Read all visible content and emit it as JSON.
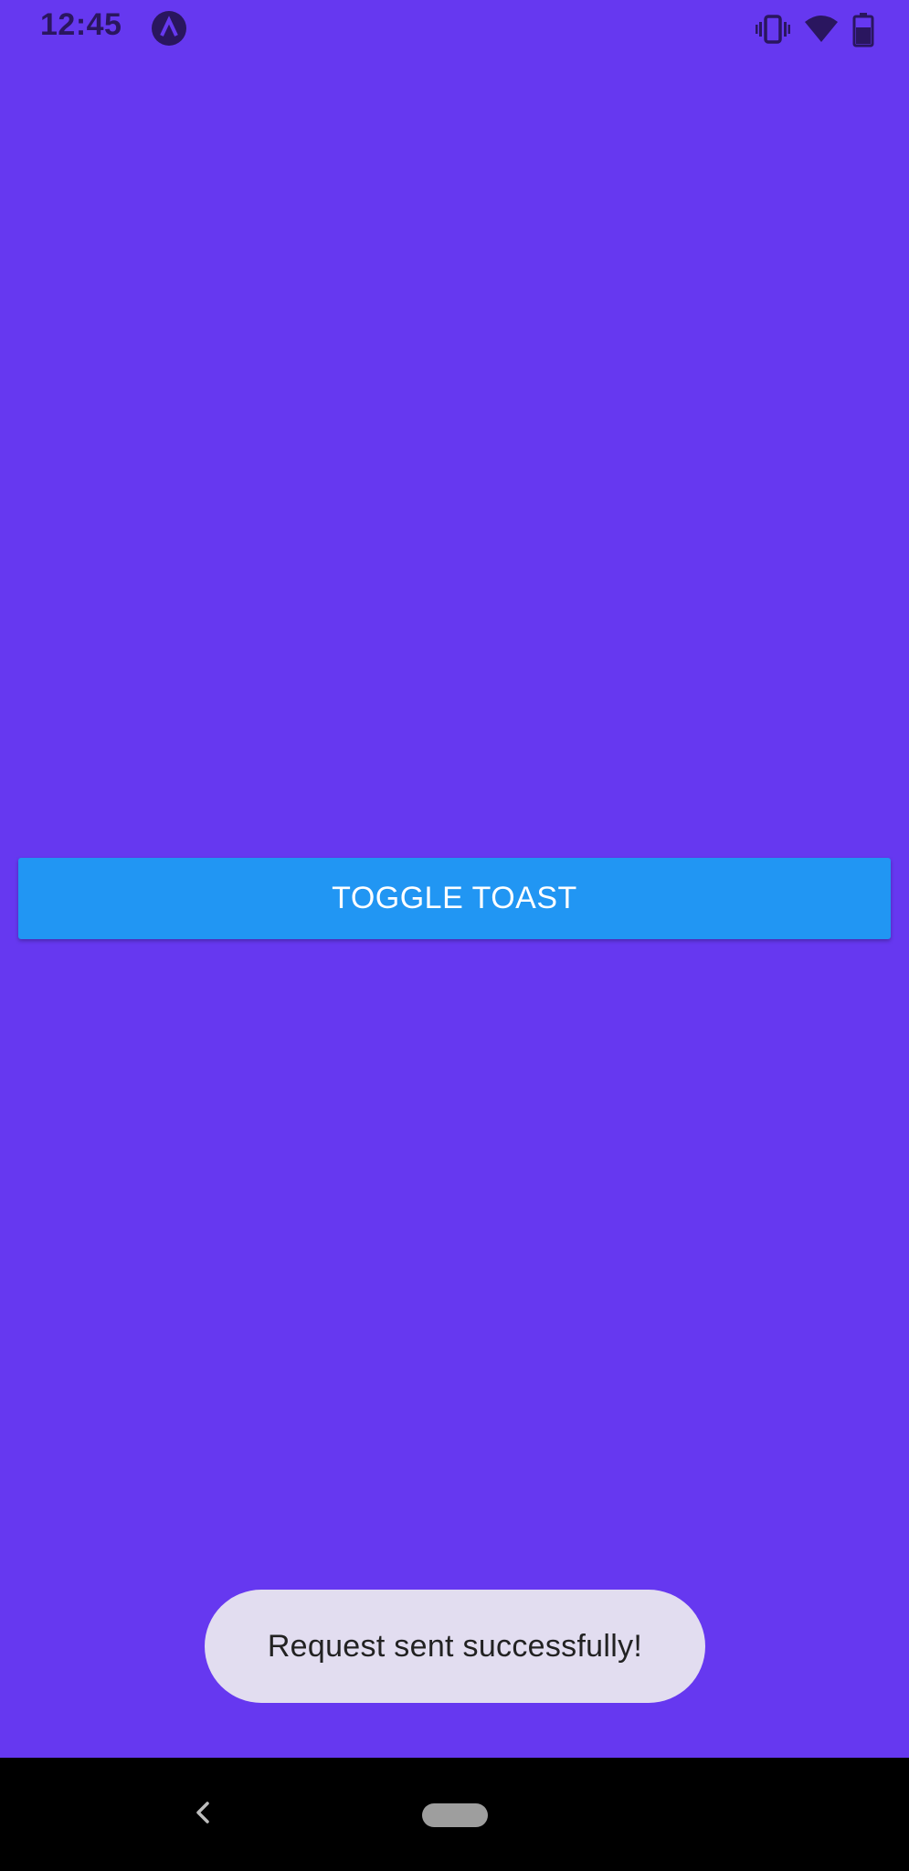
{
  "status_bar": {
    "time": "12:45",
    "icons": [
      "app-notification-icon",
      "vibrate-icon",
      "wifi-icon",
      "battery-icon"
    ],
    "icon_color": "#2a165f"
  },
  "main": {
    "background_color": "#6638F0",
    "toggle_button": {
      "label": "TOGGLE TOAST",
      "color": "#2196F3"
    }
  },
  "toast": {
    "message": "Request sent successfully!",
    "background_color": "#E2DDF0"
  },
  "nav_bar": {
    "items": [
      "back-icon",
      "home-pill"
    ]
  }
}
